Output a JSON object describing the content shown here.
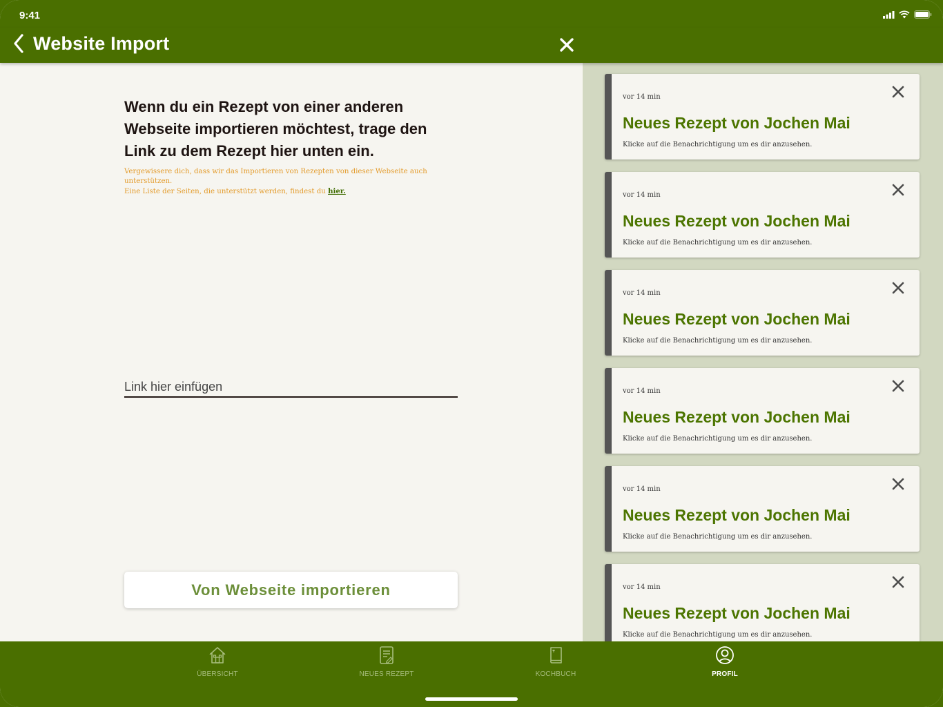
{
  "status": {
    "time": "9:41"
  },
  "nav": {
    "title": "Website Import"
  },
  "main": {
    "headline": "Wenn du ein Rezept von einer anderen Webseite importieren möchtest, trage den Link zu dem Rezept hier unten ein.",
    "hint_line1": "Vergewissere dich, dass wir das Importieren von Rezepten von dieser Webseite auch unterstützen.",
    "hint_line2": "Eine Liste der Seiten, die unterstützt werden, findest du",
    "hint_link": "hier.",
    "link_placeholder": "Link hier einfügen",
    "import_button": "Von Webseite importieren"
  },
  "notifications": [
    {
      "ago": "vor 14 min",
      "title": "Neues Rezept von Jochen Mai",
      "body": "Klicke auf die Benachrichtigung um es dir anzusehen."
    },
    {
      "ago": "vor 14 min",
      "title": "Neues Rezept von Jochen Mai",
      "body": "Klicke auf die Benachrichtigung um es dir anzusehen."
    },
    {
      "ago": "vor 14 min",
      "title": "Neues Rezept von Jochen Mai",
      "body": "Klicke auf die Benachrichtigung um es dir anzusehen."
    },
    {
      "ago": "vor 14 min",
      "title": "Neues Rezept von Jochen Mai",
      "body": "Klicke auf die Benachrichtigung um es dir anzusehen."
    },
    {
      "ago": "vor 14 min",
      "title": "Neues Rezept von Jochen Mai",
      "body": "Klicke auf die Benachrichtigung um es dir anzusehen."
    },
    {
      "ago": "vor 14 min",
      "title": "Neues Rezept von Jochen Mai",
      "body": "Klicke auf die Benachrichtigung um es dir anzusehen."
    }
  ],
  "tabs": [
    {
      "label": "ÜBERSICHT",
      "icon": "house-icon"
    },
    {
      "label": "NEUES REZEPT",
      "icon": "recipe-sheet-icon"
    },
    {
      "label": "KOCHBUCH",
      "icon": "cookbook-icon"
    },
    {
      "label": "PROFIL",
      "icon": "profile-icon",
      "active": true
    }
  ],
  "colors": {
    "primary": "#4a6f00",
    "accent_text": "#4c7500",
    "hint": "#e39b2b",
    "background": "#f6f5f0",
    "sidebar": "#d2d8c1"
  }
}
